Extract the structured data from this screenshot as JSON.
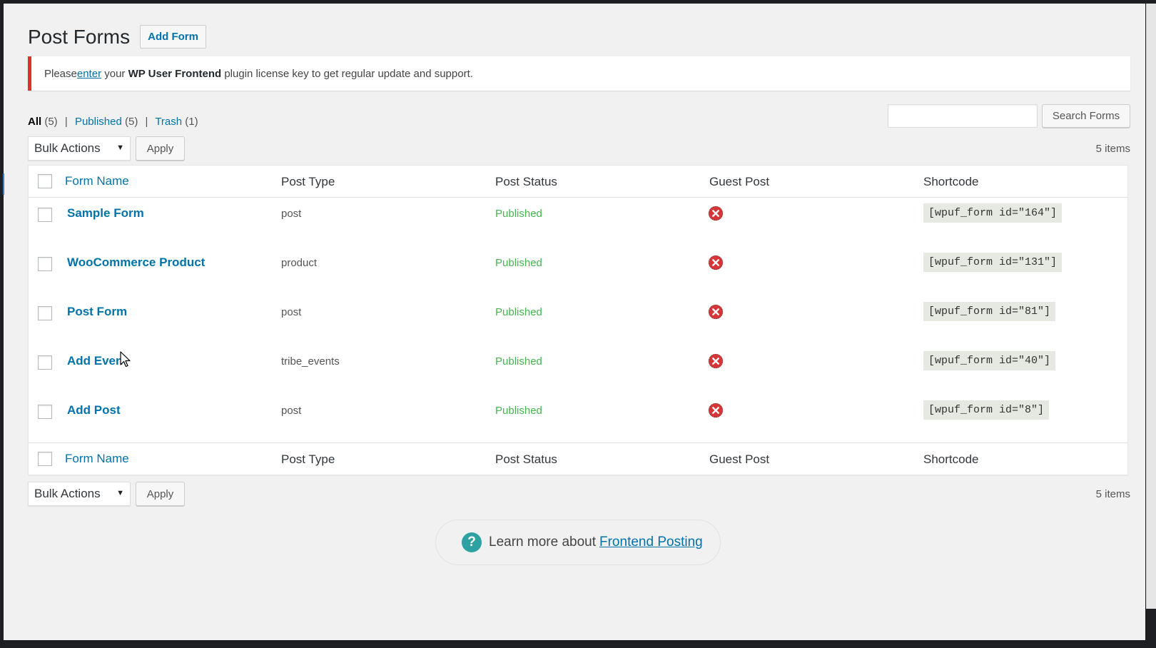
{
  "page": {
    "title": "Post Forms",
    "add_button": "Add Form"
  },
  "notice": {
    "before": "Please ",
    "link": "enter",
    "middle": " your ",
    "bold": "WP User Frontend",
    "after": " plugin license key to get regular update and support."
  },
  "filters": {
    "all_label": "All",
    "all_count": "(5)",
    "published_label": "Published",
    "published_count": "(5)",
    "trash_label": "Trash",
    "trash_count": "(1)"
  },
  "search": {
    "button": "Search Forms",
    "value": ""
  },
  "tablenav": {
    "bulk_label": "Bulk Actions",
    "apply": "Apply",
    "items_count": "5 items"
  },
  "columns": {
    "name": "Form Name",
    "post_type": "Post Type",
    "post_status": "Post Status",
    "guest_post": "Guest Post",
    "shortcode": "Shortcode"
  },
  "rows": [
    {
      "name": "Sample Form",
      "post_type": "post",
      "status": "Published",
      "guest_post_icon": "red-x-icon",
      "shortcode": "[wpuf_form id=\"164\"]"
    },
    {
      "name": "WooCommerce Product",
      "post_type": "product",
      "status": "Published",
      "guest_post_icon": "red-x-icon",
      "shortcode": "[wpuf_form id=\"131\"]"
    },
    {
      "name": "Post Form",
      "post_type": "post",
      "status": "Published",
      "guest_post_icon": "red-x-icon",
      "shortcode": "[wpuf_form id=\"81\"]"
    },
    {
      "name": "Add Event",
      "post_type": "tribe_events",
      "status": "Published",
      "guest_post_icon": "red-x-icon",
      "shortcode": "[wpuf_form id=\"40\"]"
    },
    {
      "name": "Add Post",
      "post_type": "post",
      "status": "Published",
      "guest_post_icon": "red-x-icon",
      "shortcode": "[wpuf_form id=\"8\"]"
    }
  ],
  "learn_more": {
    "text": "Learn more about",
    "link": "Frontend Posting",
    "icon": "question-icon"
  },
  "colors": {
    "link": "#0073aa",
    "published": "#46b450",
    "notice_border": "#dc3232",
    "error_icon": "#d63638",
    "help_icon": "#2ea2a2"
  }
}
